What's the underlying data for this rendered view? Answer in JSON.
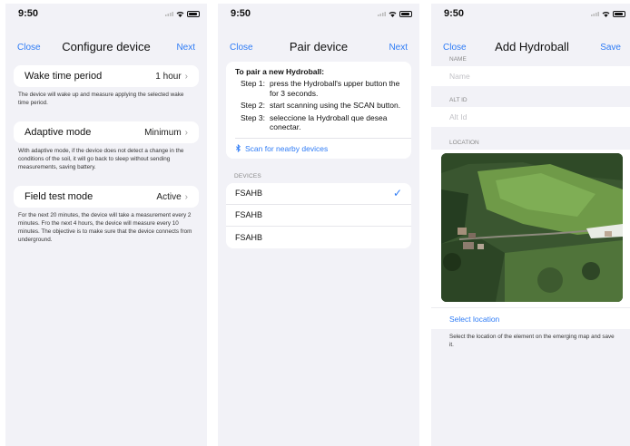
{
  "colors": {
    "accent": "#2f7cf6",
    "background": "#f2f2f7"
  },
  "screen1": {
    "time": "9:50",
    "nav": {
      "left": "Close",
      "title": "Configure device",
      "right": "Next"
    },
    "wake": {
      "label": "Wake time period",
      "value": "1 hour",
      "desc": "The device will wake up and measure applying the selected wake time period."
    },
    "adaptive": {
      "label": "Adaptive mode",
      "value": "Minimum",
      "desc": "With adaptive mode, if the device does not detect a change in the conditions of the soil, it will go back to sleep without sending measurements, saving battery."
    },
    "field_test": {
      "label": "Field test mode",
      "value": "Active",
      "desc": "For the next 20 minutes, the device will take a measurement every 2 minutes. Fro the next 4 hours, the device will measure every 10 minutes. The objective is to make sure that the device connects from underground."
    }
  },
  "screen2": {
    "time": "9:50",
    "nav": {
      "left": "Close",
      "title": "Pair device",
      "right": "Next"
    },
    "instructions_title": "To pair a new Hydroball:",
    "steps": [
      {
        "num": "Step 1:",
        "text": "press the Hydroball's upper button the for 3 seconds."
      },
      {
        "num": "Step 2:",
        "text": "start scanning using the SCAN button."
      },
      {
        "num": "Step 3:",
        "text": "seleccione la Hydroball que desea conectar."
      }
    ],
    "scan_label": "Scan for nearby devices",
    "scan_icon": "bluetooth-icon",
    "devices_header": "DEVICES",
    "devices": [
      {
        "name": "FSAHB",
        "selected": true
      },
      {
        "name": "FSAHB",
        "selected": false
      },
      {
        "name": "FSAHB",
        "selected": false
      }
    ]
  },
  "screen3": {
    "time": "9:50",
    "nav": {
      "left": "Close",
      "title": "Add Hydroball",
      "right": "Save"
    },
    "name_label": "NAME",
    "name_placeholder": "Name",
    "altid_label": "ALT ID",
    "altid_placeholder": "Alt Id",
    "location_label": "LOCATION",
    "select_location": "Select location",
    "hint": "Select the location of the element on the emerging map and save it."
  }
}
